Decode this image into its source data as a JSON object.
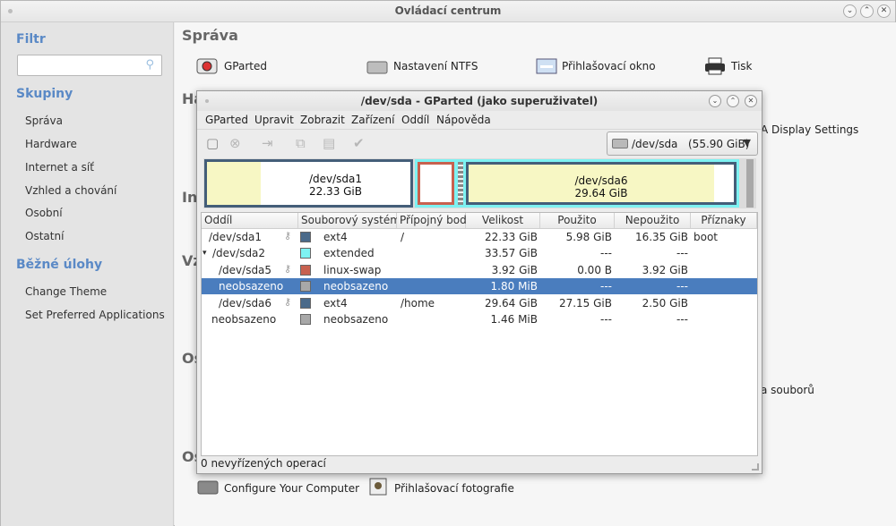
{
  "window": {
    "title": "Ovládací centrum"
  },
  "sidebar": {
    "filter_heading": "Filtr",
    "search_placeholder": "",
    "groups_heading": "Skupiny",
    "groups": [
      "Správa",
      "Hardware",
      "Internet a síť",
      "Vzhled a chování",
      "Osobní",
      "Ostatní"
    ],
    "tasks_heading": "Běžné úlohy",
    "tasks": [
      "Change Theme",
      "Set Preferred Applications"
    ]
  },
  "content": {
    "section_sprava": "Správa",
    "tools_top": [
      "GParted",
      "Nastavení NTFS",
      "Přihlašovací okno",
      "Tisk"
    ],
    "partial_headings": [
      "Ha",
      "In",
      "Vz",
      "Os",
      "Os"
    ],
    "partial_right_1": "A Display Settings",
    "partial_right_2": "a souborů",
    "tools_bottom": [
      "Configure Your Computer",
      "Přihlašovací fotografie"
    ]
  },
  "gparted": {
    "title": "/dev/sda - GParted (jako superuživatel)",
    "menu": [
      "GParted",
      "Upravit",
      "Zobrazit",
      "Zařízení",
      "Oddíl",
      "Nápověda"
    ],
    "device": {
      "name": "/dev/sda",
      "size": "(55.90 GiB)"
    },
    "map": [
      {
        "name": "/dev/sda1",
        "size": "22.33 GiB"
      },
      {
        "name": "/dev/sda6",
        "size": "29.64 GiB"
      }
    ],
    "columns": [
      "Oddíl",
      "Souborový systém",
      "Přípojný bod",
      "Velikost",
      "Použito",
      "Nepoužito",
      "Příznaky"
    ],
    "rows": [
      {
        "part": "/dev/sda1",
        "fs": "ext4",
        "mount": "/",
        "size": "22.33 GiB",
        "used": "5.98 GiB",
        "unused": "16.35 GiB",
        "flags": "boot",
        "color": "#4a6a8a"
      },
      {
        "part": "/dev/sda2",
        "fs": "extended",
        "mount": "",
        "size": "33.57 GiB",
        "used": "---",
        "unused": "---",
        "flags": "",
        "color": "#7ef2f2"
      },
      {
        "part": "/dev/sda5",
        "fs": "linux-swap",
        "mount": "",
        "size": "3.92 GiB",
        "used": "0.00 B",
        "unused": "3.92 GiB",
        "flags": "",
        "color": "#c8614f"
      },
      {
        "part": "neobsazeno",
        "fs": "neobsazeno",
        "mount": "",
        "size": "1.80 MiB",
        "used": "---",
        "unused": "---",
        "flags": "",
        "color": "#a8a8a8"
      },
      {
        "part": "/dev/sda6",
        "fs": "ext4",
        "mount": "/home",
        "size": "29.64 GiB",
        "used": "27.15 GiB",
        "unused": "2.50 GiB",
        "flags": "",
        "color": "#4a6a8a"
      },
      {
        "part": "neobsazeno",
        "fs": "neobsazeno",
        "mount": "",
        "size": "1.46 MiB",
        "used": "---",
        "unused": "---",
        "flags": "",
        "color": "#a8a8a8"
      }
    ],
    "status": "0 nevyřízených operací"
  }
}
